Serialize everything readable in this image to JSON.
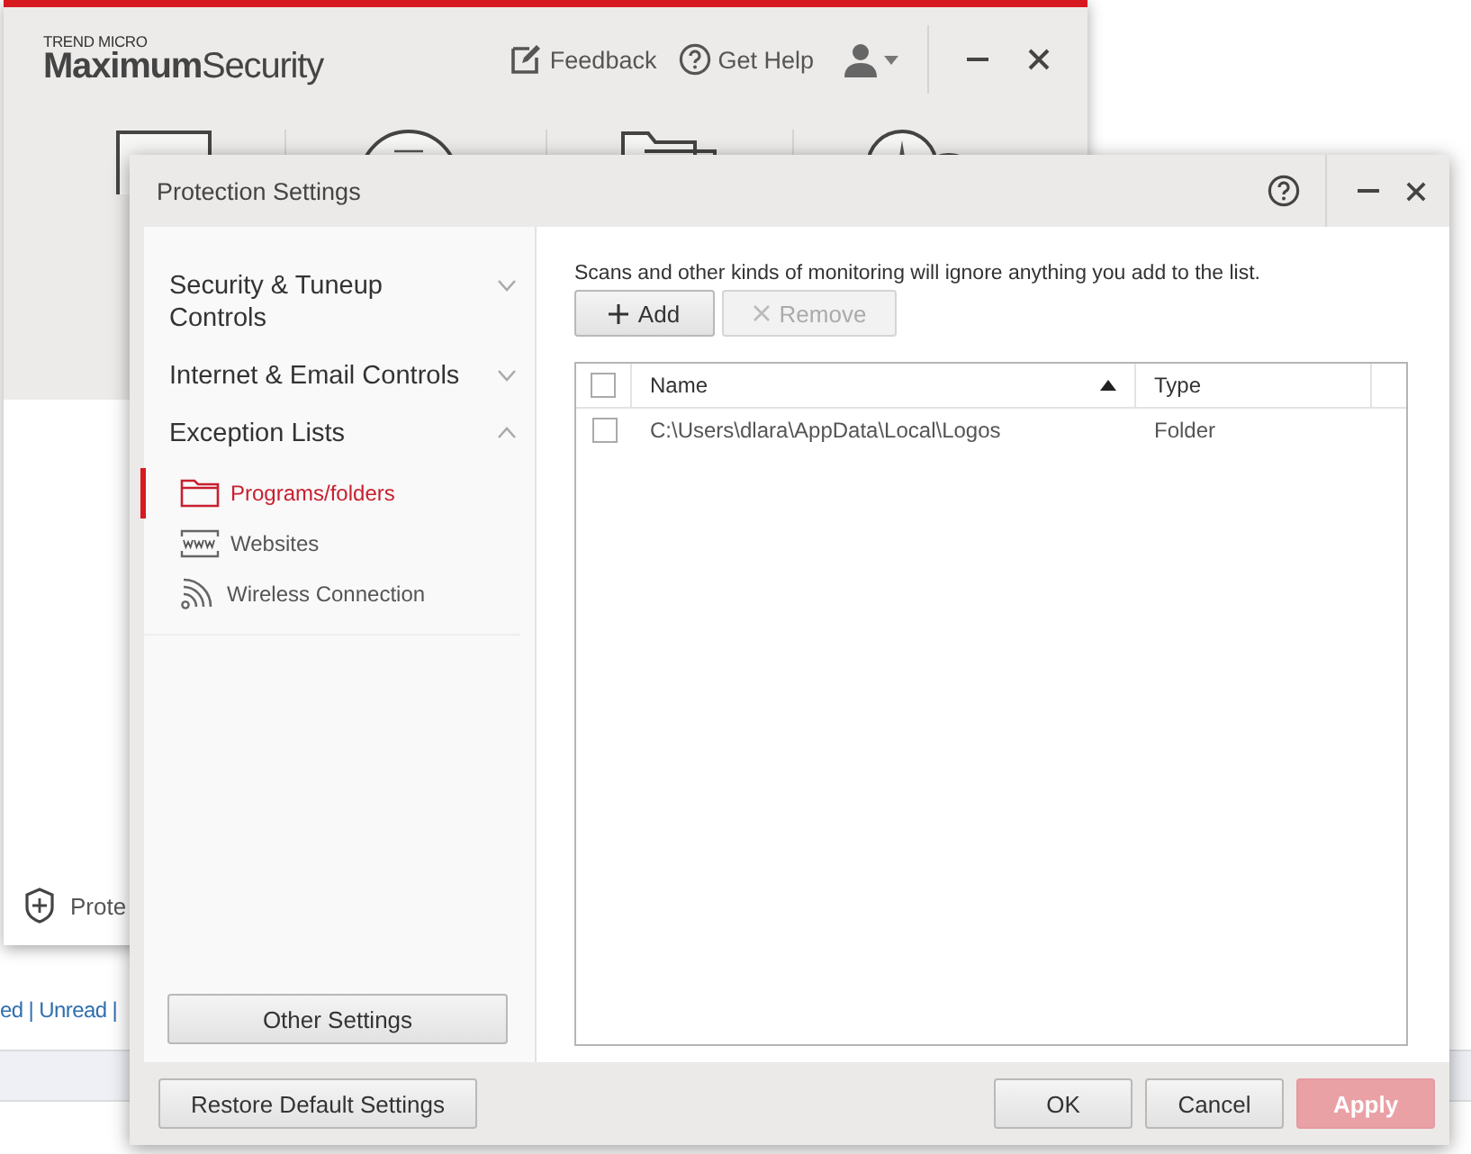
{
  "app_window": {
    "brand": "TREND MICRO",
    "product": "**Maximum**Security",
    "actions": [
      {
        "kind": "feedback",
        "label": "Feedback"
      },
      {
        "kind": "help",
        "label": "Get Help"
      }
    ],
    "status_label": "Prote"
  },
  "background": {
    "links_text": "ed | Unread |"
  },
  "dialog": {
    "title": "Protection Settings",
    "sidebar": {
      "sections": [
        {
          "label": "Security & Tuneup Controls",
          "expanded": false
        },
        {
          "label": "Internet & Email Controls",
          "expanded": false
        },
        {
          "label": "Exception Lists",
          "expanded": true,
          "children": [
            {
              "kind": "folder",
              "label": "Programs/folders",
              "selected": true
            },
            {
              "kind": "web",
              "label": "Websites",
              "selected": false
            },
            {
              "kind": "wireless",
              "label": "Wireless Connection",
              "selected": false
            }
          ]
        }
      ],
      "other_settings": "Other Settings"
    },
    "description": "Scans and other kinds of monitoring will ignore anything you add to the list.",
    "toolbar": [
      {
        "kind": "add",
        "label": "Add",
        "disabled": false
      },
      {
        "kind": "remove",
        "label": "Remove",
        "disabled": true
      }
    ],
    "table": {
      "header_checked": false,
      "columns": [
        {
          "label": "Name",
          "sorted": true
        },
        {
          "label": "Type",
          "sorted": false
        }
      ],
      "rows": [
        {
          "checked": false,
          "name": "C:\\Users\\dlara\\AppData\\Local\\Logos",
          "type": "Folder"
        }
      ]
    },
    "footer": {
      "restore": "Restore Default Settings",
      "buttons": [
        {
          "kind": "ok",
          "label": "OK",
          "disabled": false
        },
        {
          "kind": "cancel",
          "label": "Cancel",
          "disabled": false
        },
        {
          "kind": "apply",
          "label": "Apply",
          "disabled": true
        }
      ]
    }
  }
}
